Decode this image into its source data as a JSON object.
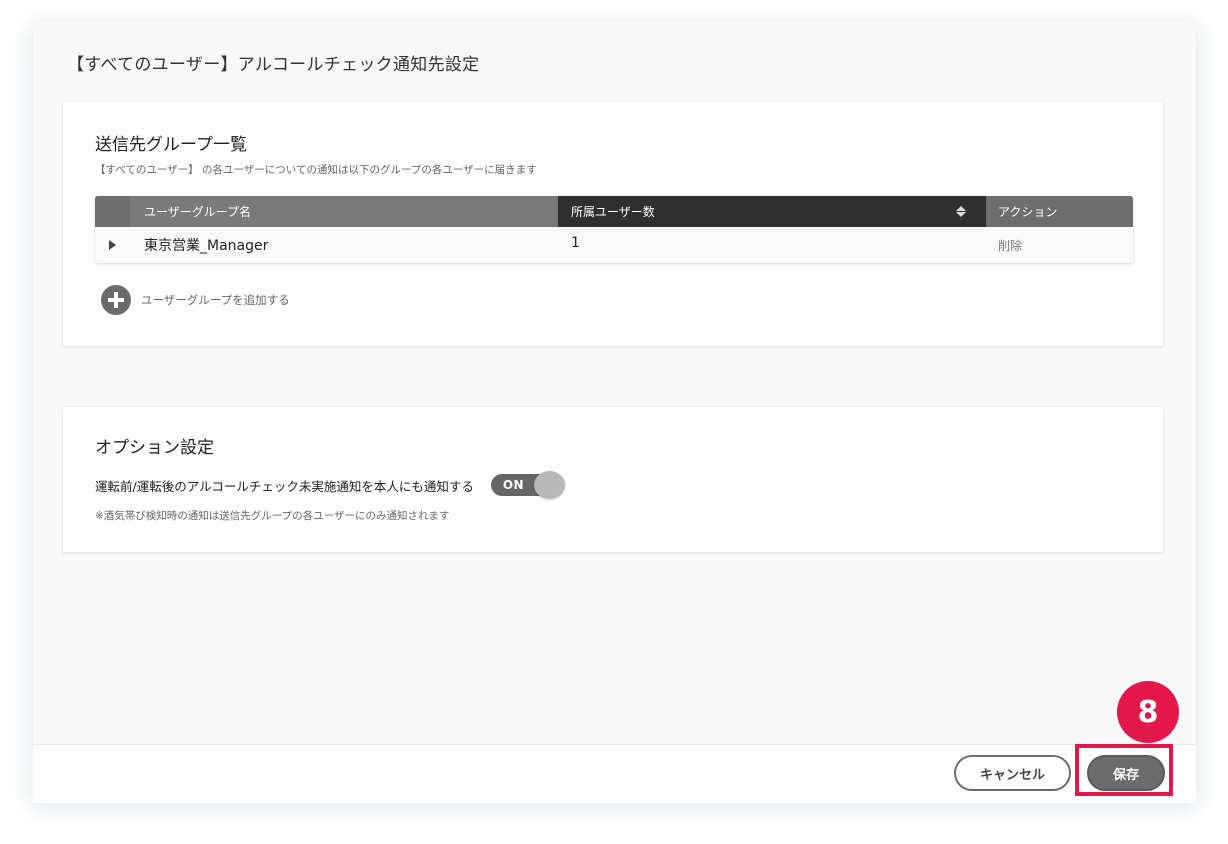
{
  "dialog": {
    "title": "【すべてのユーザー】アルコールチェック通知先設定"
  },
  "groups_card": {
    "title": "送信先グループ一覧",
    "subtitle": "【すべてのユーザー】 の各ユーザーについての通知は以下のグループの各ユーザーに届きます",
    "table": {
      "columns": [
        "ユーザーグループ名",
        "所属ユーザー数",
        "アクション"
      ],
      "sorted_column": "所属ユーザー数",
      "rows": [
        {
          "name": "東京営業_Manager",
          "count": "1",
          "action": "削除"
        }
      ]
    },
    "add_group_label": "ユーザーグループを追加する"
  },
  "options_card": {
    "title": "オプション設定",
    "option_label": "運転前/運転後のアルコールチェック未実施通知を本人にも通知する",
    "toggle_label": "ON",
    "toggle_state": true,
    "note": "※酒気帯び検知時の通知は送信先グループの各ユーザーにのみ通知されます"
  },
  "footer": {
    "cancel_label": "キャンセル",
    "save_label": "保存"
  },
  "annotation": {
    "step_number": "8",
    "color": "#e3174a"
  }
}
